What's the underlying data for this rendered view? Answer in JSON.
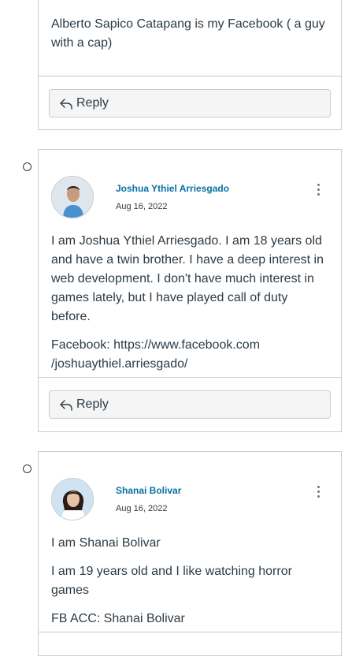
{
  "post1": {
    "text": "Alberto Sapico Catapang is my Facebook ( a guy with a cap)",
    "reply_label": "Reply"
  },
  "post2": {
    "author": "Joshua Ythiel Arriesgado",
    "date": "Aug 16, 2022",
    "paragraph1": "I am Joshua Ythiel Arriesgado. I am 18 years old and have a twin brother. I have a deep interest in web development. I don't have much interest in games lately, but I have played call of duty before.",
    "paragraph2_line1": "Facebook: https://www.facebook.com",
    "paragraph2_line2": "/joshuaythiel.arriesgado/",
    "reply_label": "Reply"
  },
  "post3": {
    "author": "Shanai Bolivar",
    "date": "Aug 16, 2022",
    "paragraph1": "I am Shanai Bolivar",
    "paragraph2": "I am 19 years old and I like watching horror games",
    "paragraph3": "FB ACC: Shanai Bolivar"
  },
  "colors": {
    "author_link": "#0770a3",
    "border": "#c7cdd1",
    "text": "#2d3b45"
  }
}
